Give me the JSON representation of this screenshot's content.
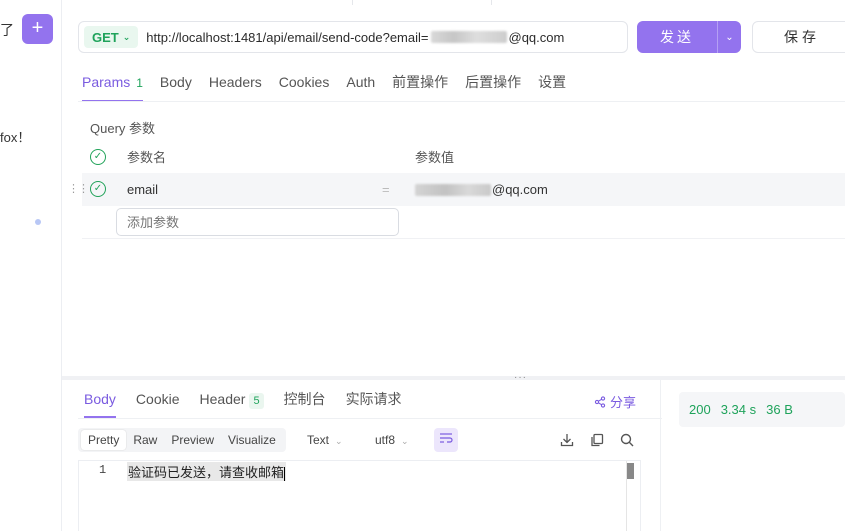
{
  "sidebar": {
    "cut_text_top": "了",
    "add_icon": "plus-icon",
    "cut_text_mid": "fox！"
  },
  "request": {
    "method": "GET",
    "url_prefix": "http://localhost:1481/api/email/send-code?email=",
    "url_suffix": "@qq.com",
    "send_label": "发送",
    "save_label": "保存"
  },
  "req_tabs": [
    {
      "label": "Params",
      "count": "1"
    },
    {
      "label": "Body"
    },
    {
      "label": "Headers"
    },
    {
      "label": "Cookies"
    },
    {
      "label": "Auth"
    },
    {
      "label": "前置操作"
    },
    {
      "label": "后置操作"
    },
    {
      "label": "设置"
    }
  ],
  "params": {
    "section_title": "Query 参数",
    "col_name": "参数名",
    "col_value": "参数值",
    "rows": [
      {
        "name": "email",
        "eq": "=",
        "value_suffix": "@qq.com"
      }
    ],
    "add_placeholder": "添加参数"
  },
  "response": {
    "tabs": [
      {
        "label": "Body"
      },
      {
        "label": "Cookie"
      },
      {
        "label": "Header",
        "count": "5"
      },
      {
        "label": "控制台"
      },
      {
        "label": "实际请求"
      }
    ],
    "share_label": "分享",
    "formats": [
      "Pretty",
      "Raw",
      "Preview",
      "Visualize"
    ],
    "type_select": "Text",
    "encoding_select": "utf8",
    "line_number": "1",
    "line_text": "验证码已发送，请查收邮箱"
  },
  "status": {
    "code": "200",
    "time": "3.34 s",
    "size": "36 B"
  },
  "colors": {
    "accent": "#9373ee",
    "success": "#1fa35b"
  }
}
